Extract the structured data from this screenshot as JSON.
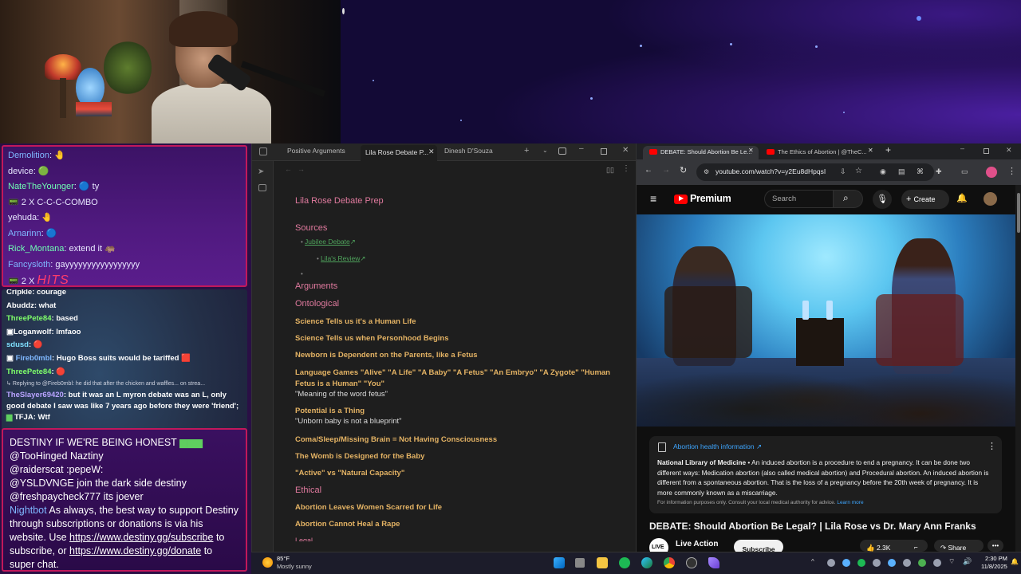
{
  "chat_top": [
    {
      "user": "Demolition",
      "text": "",
      "color": "#7fb8ff"
    },
    {
      "user": "device",
      "text": "",
      "color": "#ffffff"
    },
    {
      "user": "NateTheYounger",
      "text": "ty",
      "color": "#70ffb5"
    },
    {
      "combo": "2 X C-C-C-COMBO"
    },
    {
      "user": "yehuda",
      "text": "",
      "color": "#ffffff"
    },
    {
      "user": "Arnarinn",
      "text": "",
      "color": "#7fb8ff"
    },
    {
      "user": "Rick_Montana",
      "text": "extend it",
      "color": "#70ffb5"
    },
    {
      "user": "Fancysloth",
      "text": "gayyyyyyyyyyyyyyyyy",
      "color": "#7fb8ff"
    },
    {
      "hits_count": "2 X",
      "hits_label": "HITS"
    }
  ],
  "chat_mid": [
    {
      "user": "Cripkle",
      "text": "courage",
      "color": "#ffffff"
    },
    {
      "user": "Abuddz",
      "text": "what",
      "color": "#ffffff"
    },
    {
      "user": "ThreePete84",
      "text": "based",
      "color": "#7fff6a"
    },
    {
      "user": "Loganwolf",
      "text": "lmfaoo",
      "color": "#ffffff"
    },
    {
      "user": "sdusd",
      "text": "",
      "color": "#7fe0ff"
    },
    {
      "user": "Fireb0mbl",
      "text": "Hugo Boss suits would be tariffed",
      "color": "#7fb8ff"
    },
    {
      "user": "ThreePete84",
      "text": "",
      "color": "#7fff6a"
    },
    {
      "reply": "Replying to @Fireb0mbl: he did that after the chicken and waffles... on strea..."
    },
    {
      "user": "TheSlayer69420",
      "text": "but it was an L myron debate was an L, only good debate I saw was like 7 years ago before they were 'friend';",
      "color": "#b9a3ff"
    },
    {
      "user": "TFJA",
      "text": "Wtf",
      "color": "#ffffff"
    }
  ],
  "chat_bottom": [
    {
      "user": "",
      "text": "DESTINY IF WE'RE BEING HONEST"
    },
    {
      "user": "@TooHinged",
      "text": "Naztiny"
    },
    {
      "user": "@raiderscat",
      "text": ":pepeW:"
    },
    {
      "user": "@YSLDVNGE",
      "text": "join the dark side destiny"
    },
    {
      "user": "@freshpaycheck777",
      "text": "its joever"
    }
  ],
  "nightbot": {
    "user": "Nightbot",
    "text1": "As always, the best way to support Destiny through subscriptions or donations is via his website. Use",
    "link1": "https://www.destiny.gg/subscribe",
    "text2": "to subscribe, or",
    "link2": "https://www.destiny.gg/donate",
    "text3": "to super chat."
  },
  "obsidian": {
    "tabs": [
      "Positive Arguments",
      "Lila Rose Debate P...",
      "Dinesh D'Souza"
    ],
    "title": "Lila Rose Debate Prep",
    "sources_heading": "Sources",
    "source_links": [
      "Jubilee Debate",
      "Lila's Review"
    ],
    "arguments_heading": "Arguments",
    "ontological_heading": "Ontological",
    "ontological_items": [
      {
        "title": "Science Tells us it's a Human Life",
        "note": ""
      },
      {
        "title": "Science Tells us when Personhood Begins",
        "note": ""
      },
      {
        "title": "Newborn is Dependent on the Parents, like a Fetus",
        "note": ""
      },
      {
        "title": "Language Games \"Alive\" \"A Life\" \"A Baby\" \"A Fetus\" \"An Embryo\" \"A Zygote\" \"Human Fetus is a Human\" \"You\"",
        "note": "\"Meaning of the word fetus\""
      },
      {
        "title": "Potential is a Thing",
        "note": "\"Unborn baby is not a blueprint\""
      },
      {
        "title": "Coma/Sleep/Missing Brain = Not Having Consciousness",
        "note": ""
      },
      {
        "title": "The Womb is Designed for the Baby",
        "note": ""
      },
      {
        "title": "\"Active\" vs \"Natural Capacity\"",
        "note": ""
      }
    ],
    "ethical_heading": "Ethical",
    "ethical_items": [
      "Abortion Leaves Women Scarred for Life",
      "Abortion Cannot Heal a Rape"
    ],
    "cut_heading": "Legal"
  },
  "chrome": {
    "tabs": [
      "DEBATE: Should Abortion Be Le...",
      "The Ethics of Abortion | @TheC..."
    ],
    "url": "youtube.com/watch?v=y2Eu8dHpqsI",
    "yt_brand": "Premium",
    "search_placeholder": "Search",
    "create_label": "Create",
    "info_title": "Abortion health information ↗",
    "info_source": "National Library of Medicine",
    "info_body": "An induced abortion is a procedure to end a pregnancy. It can be done two different ways: Medication abortion (also called medical abortion) and Procedural abortion. An induced abortion is different from a spontaneous abortion. That is the loss of a pregnancy before the 20th week of pregnancy. It is more commonly known as a miscarriage.",
    "info_note": "For information purposes only. Consult your local medical authority for advice.",
    "learn_more": "Learn more",
    "video_title": "DEBATE: Should Abortion Be Legal? | Lila Rose vs Dr. Mary Ann Franks",
    "channel": "Live Action",
    "subscribe": "Subscribe",
    "likes": "2.3K",
    "share": "Share"
  },
  "taskbar": {
    "temp": "85°F",
    "weather": "Mostly sunny",
    "time": "2:30 PM",
    "date": "11/8/2025"
  },
  "colors": {
    "accent_pink": "#c2185b",
    "obsidian_heading": "#e07a9e",
    "obsidian_subheading": "#e4b364",
    "obsidian_link": "#4fa35c",
    "youtube_red": "#ff0000"
  }
}
